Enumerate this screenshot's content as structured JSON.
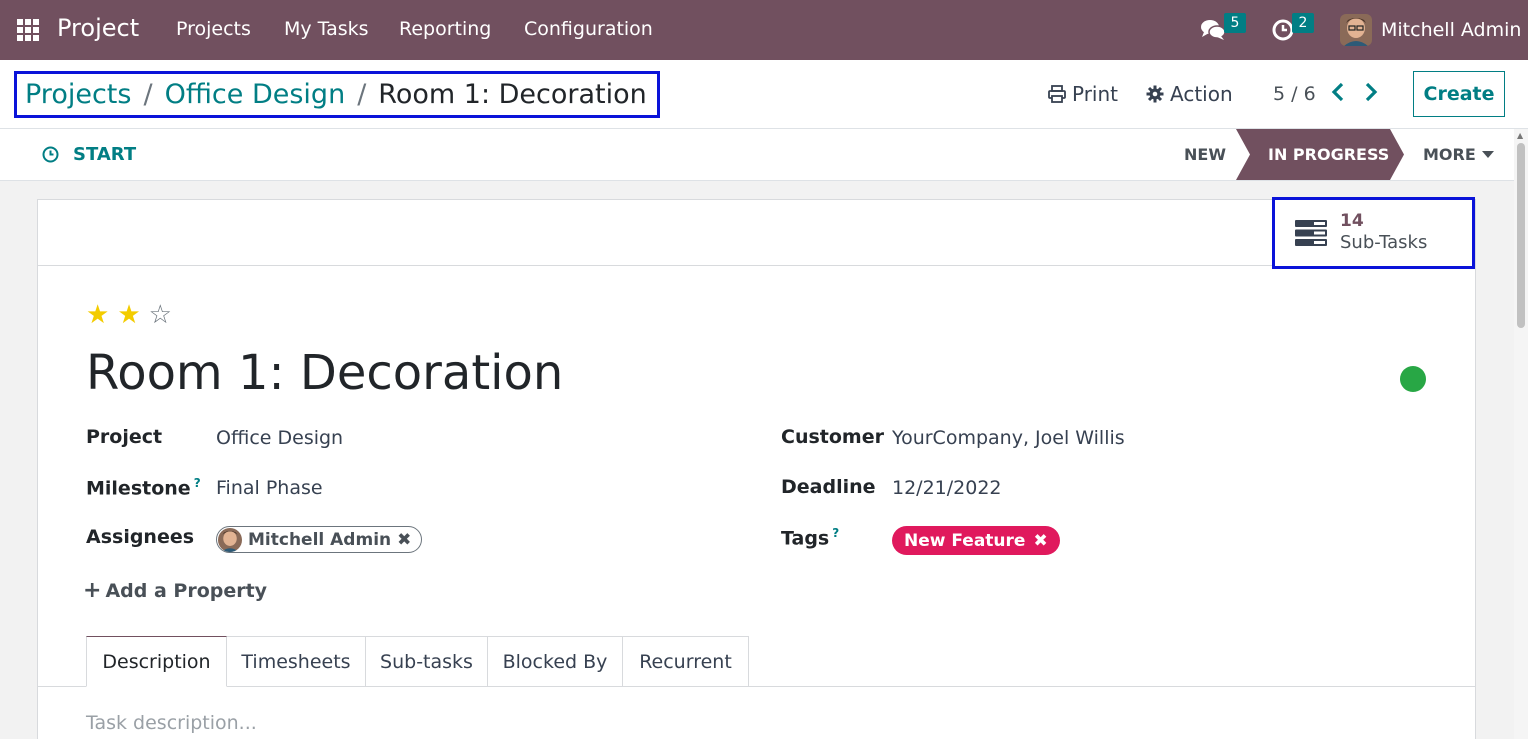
{
  "navbar": {
    "app_name": "Project",
    "menus": [
      "Projects",
      "My Tasks",
      "Reporting",
      "Configuration"
    ],
    "messages_count": "5",
    "activities_count": "2",
    "user_name": "Mitchell Admin"
  },
  "breadcrumb": {
    "items": [
      "Projects",
      "Office Design"
    ],
    "separator": "/",
    "current": "Room 1: Decoration"
  },
  "control_panel": {
    "print_label": "Print",
    "action_label": "Action",
    "pager": "5 / 6",
    "create_label": "Create"
  },
  "statusbar": {
    "start_label": "START",
    "stages": [
      "NEW",
      "IN PROGRESS",
      "MORE"
    ],
    "active_stage": "IN PROGRESS"
  },
  "button_box": {
    "subtasks_count": "14",
    "subtasks_label": "Sub-Tasks"
  },
  "task": {
    "priority_stars": 2,
    "priority_max": 3,
    "title": "Room 1: Decoration",
    "kanban_state_color": "#28a745"
  },
  "fields": {
    "project_label": "Project",
    "project_value": "Office Design",
    "milestone_label": "Milestone",
    "milestone_help": "?",
    "milestone_value": "Final Phase",
    "assignees_label": "Assignees",
    "assignee_name": "Mitchell Admin",
    "customer_label": "Customer",
    "customer_value": "YourCompany, Joel Willis",
    "deadline_label": "Deadline",
    "deadline_value": "12/21/2022",
    "tags_label": "Tags",
    "tags_help": "?",
    "tag_value": "New Feature"
  },
  "add_property_label": "Add a Property",
  "tabs": [
    "Description",
    "Timesheets",
    "Sub-tasks",
    "Blocked By",
    "Recurrent"
  ],
  "description_placeholder": "Task description...",
  "colors": {
    "brand": "#71505f",
    "accent": "#017e84",
    "tag": "#e0195d",
    "highlight_box": "#0a13d9"
  }
}
